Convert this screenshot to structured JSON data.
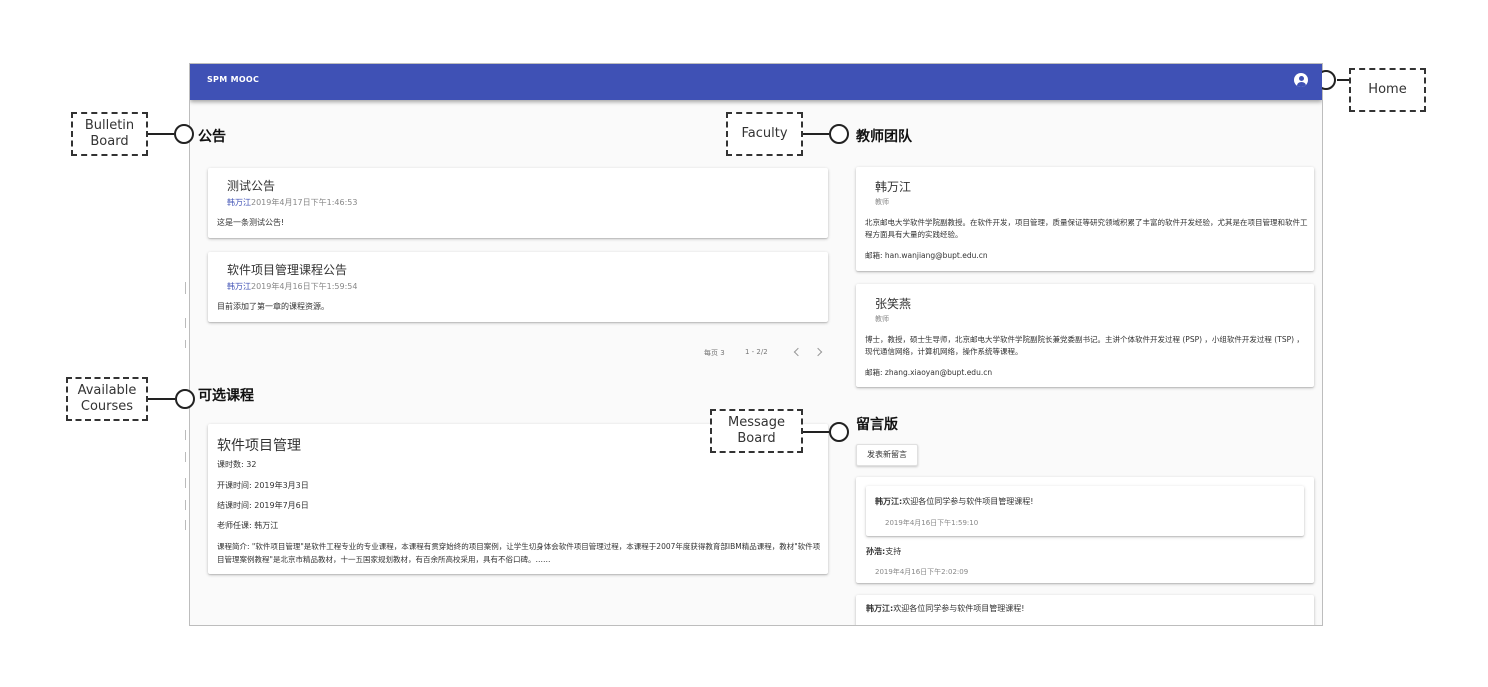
{
  "app": {
    "brand": "SPM MOOC",
    "account_icon": "account-circle-icon"
  },
  "bulletin": {
    "title": "公告",
    "items": [
      {
        "title": "测试公告",
        "author": "韩万江",
        "time": "2019年4月17日下午1:46:53",
        "body": "这是一条测试公告!"
      },
      {
        "title": "软件项目管理课程公告",
        "author": "韩万江",
        "time": "2019年4月16日下午1:59:54",
        "body": "目前添加了第一章的课程资源。"
      }
    ],
    "pager": {
      "per_page_label": "每页 3",
      "range": "1 - 2/2"
    }
  },
  "courses": {
    "title": "可选课程",
    "items": [
      {
        "name": "软件项目管理",
        "hours": "课时数: 32",
        "start": "开课时间: 2019年3月3日",
        "end": "结课时间: 2019年7月6日",
        "teacher": "老师任课: 韩万江",
        "intro": "课程简介: \"软件项目管理\"是软件工程专业的专业课程，本课程有贯穿始终的项目案例，让学生切身体会软件项目管理过程，本课程于2007年度获得教育部IBM精品课程，教材\"软件项目管理案例教程\"是北京市精品教材，十一五国家规划教材，有百余所高校采用，具有不俗口碑。……"
      }
    ]
  },
  "faculty": {
    "title": "教师团队",
    "items": [
      {
        "name": "韩万江",
        "role": "教师",
        "bio": "北京邮电大学软件学院副教授。在软件开发，项目管理，质量保证等研究领域积累了丰富的软件开发经验，尤其是在项目管理和软件工程方面具有大量的实践经验。",
        "email": "邮箱: han.wanjiang@bupt.edu.cn"
      },
      {
        "name": "张笑燕",
        "role": "教师",
        "bio": "博士，教授，硕士生导师，北京邮电大学软件学院副院长兼党委副书记。主讲个体软件开发过程 (PSP) ，小组软件开发过程 (TSP) ，现代通信网络，计算机网络，操作系统等课程。",
        "email": "邮箱: zhang.xiaoyan@bupt.edu.cn"
      }
    ]
  },
  "messages": {
    "title": "留言版",
    "new_button": "发表新留言",
    "thread1": {
      "quote_author": "韩万江:",
      "quote_text": "欢迎各位同学参与软件项目管理课程!",
      "quote_time": "2019年4月16日下午1:59:10",
      "reply_author": "孙浩:",
      "reply_text": "支持",
      "reply_time": "2019年4月16日下午2:02:09"
    },
    "thread2": {
      "author": "韩万江:",
      "text": "欢迎各位同学参与软件项目管理课程!"
    }
  },
  "annotations": {
    "home": "Home",
    "bulletin": "Bulletin\nBoard",
    "faculty": "Faculty",
    "courses": "Available\nCourses",
    "message": "Message\nBoard"
  }
}
